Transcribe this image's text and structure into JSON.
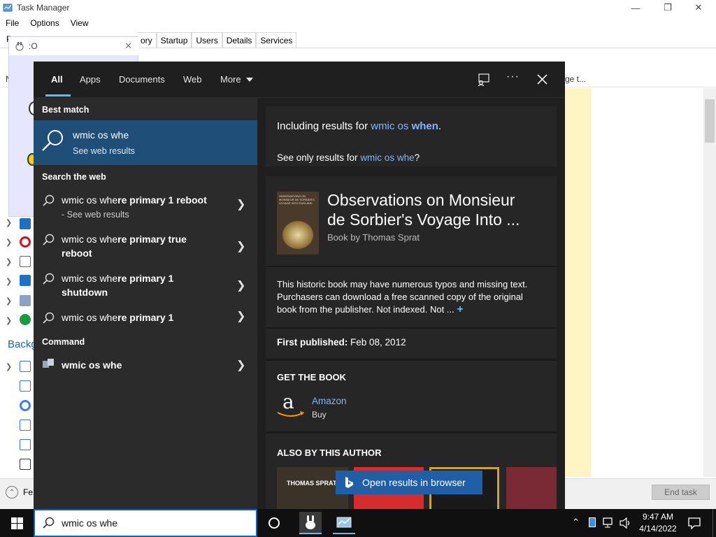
{
  "taskmgr": {
    "title": "Task Manager",
    "menu": [
      "File",
      "Options",
      "View"
    ],
    "tabs": [
      "ory",
      "Startup",
      "Users",
      "Details",
      "Services"
    ],
    "frag_left_p": "P",
    "frag_left_n": "N",
    "frag_right_tab": "ge t...",
    "background_label": "Backg",
    "fewer_details": "Fe",
    "end_task": "End task"
  },
  "mini_window": {
    "title": ":O"
  },
  "search": {
    "tabs": {
      "all": "All",
      "apps": "Apps",
      "documents": "Documents",
      "web": "Web",
      "more": "More"
    },
    "best_match_label": "Best match",
    "best_match": {
      "title": "wmic os whe",
      "subtitle": "See web results"
    },
    "search_web_label": "Search the web",
    "web_results": [
      {
        "normal": "wmic os whe",
        "bold": "re primary 1 reboot",
        "sub": "- See web results"
      },
      {
        "normal": "wmic os whe",
        "bold": "re primary true",
        "line2": "reboot"
      },
      {
        "normal": "wmic os whe",
        "bold": "re primary 1",
        "line2": "shutdown"
      },
      {
        "normal": "wmic os whe",
        "bold": "re primary 1"
      }
    ],
    "command_label": "Command",
    "command": {
      "title": "wmic os whe"
    },
    "including_prefix": "Including results for ",
    "including_link": "wmic os ",
    "including_bold": "when",
    "including_end": ".",
    "only_prefix": "See only results for ",
    "only_link": "wmic os whe",
    "only_end": "?",
    "book": {
      "title_line1": "Observations on Monsieur",
      "title_line2": "de Sorbier's Voyage Into ...",
      "by": "Book by Thomas Sprat",
      "cover_text": "OBSERVATIONS ON MONSIEUR DE SORBIER'S VOYAGE INTO ENGLAND",
      "desc1": "This historic book may have numerous typos and missing text.",
      "desc2": "Purchasers can download a free scanned copy of the original",
      "desc3": "book from the publisher. Not indexed. Not ...",
      "published_label": "First published:",
      "published_value": "Feb 08, 2012",
      "get_label": "GET THE BOOK",
      "store": "Amazon",
      "store_action": "Buy",
      "also_label": "ALSO BY THIS AUTHOR",
      "also_thumb1": "THOMAS SPRAT"
    },
    "open_browser": "Open results in browser",
    "query": "wmic os whe"
  },
  "tray": {
    "time": "9:47 AM",
    "date": "4/14/2022"
  }
}
